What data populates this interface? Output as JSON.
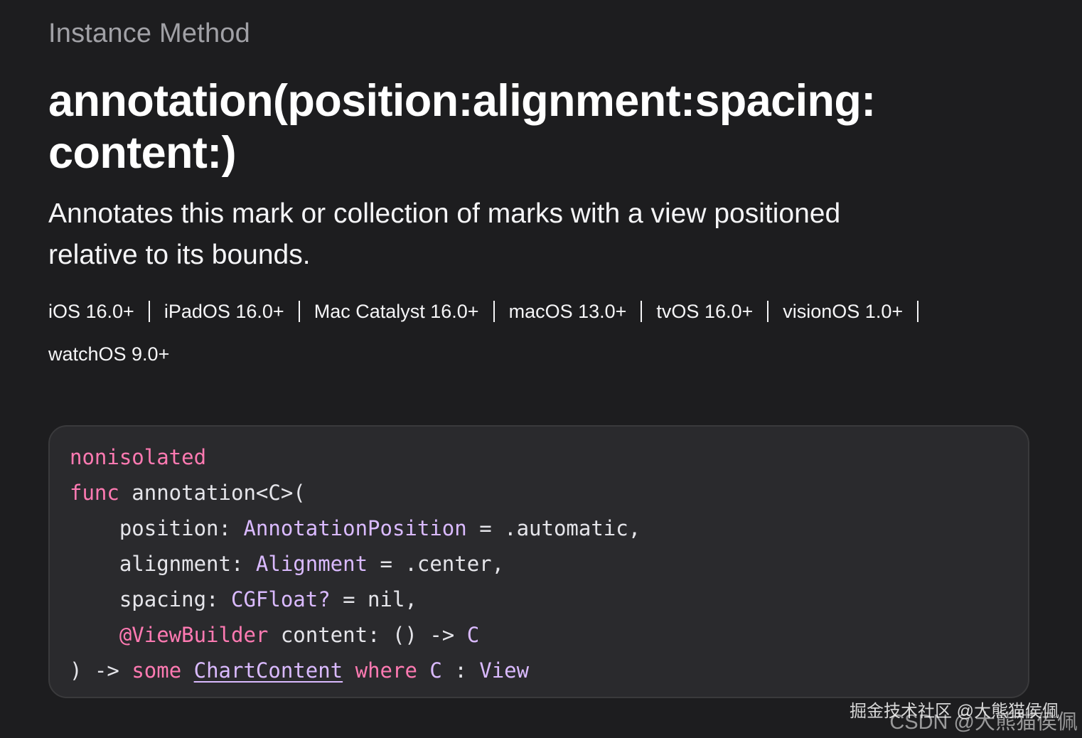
{
  "header": {
    "eyebrow": "Instance Method",
    "title_line1": "annotation(position:alignment:spacing:",
    "title_line2": "content:)",
    "abstract_line1": "Annotates this mark or collection of marks with a view positioned",
    "abstract_line2": "relative to its bounds."
  },
  "availability": {
    "platforms": [
      "iOS 16.0+",
      "iPadOS 16.0+",
      "Mac Catalyst 16.0+",
      "macOS 13.0+",
      "tvOS 16.0+",
      "visionOS 1.0+",
      "watchOS 9.0+"
    ]
  },
  "declaration": {
    "line1": {
      "kw": "nonisolated"
    },
    "line2": {
      "kw": "func",
      "rest": " annotation<C>("
    },
    "line3": {
      "indent": "    ",
      "label": "position: ",
      "type": "AnnotationPosition",
      "rest": " = .automatic,"
    },
    "line4": {
      "indent": "    ",
      "label": "alignment: ",
      "type": "Alignment",
      "rest": " = .center,"
    },
    "line5": {
      "indent": "    ",
      "label": "spacing: ",
      "type": "CGFloat?",
      "rest": " = nil,"
    },
    "line6": {
      "indent": "    ",
      "attr": "@ViewBuilder",
      "label": " content: () -> ",
      "type": "C"
    },
    "line7": {
      "start": ") -> ",
      "kw1": "some",
      "link": "ChartContent",
      "kw2": "where",
      "type1": "C",
      "mid": " : ",
      "type2": "View"
    }
  },
  "watermark": {
    "line1": "掘金技术社区 @大熊猫侯佩",
    "line2": "CSDN @大熊猫侯佩"
  },
  "colors": {
    "background": "#1d1d1f",
    "code_background": "#2a2a2d",
    "keyword": "#ff7ab2",
    "type": "#dabaff",
    "plain": "#e5e5ea",
    "eyebrow": "#a1a1a6"
  }
}
